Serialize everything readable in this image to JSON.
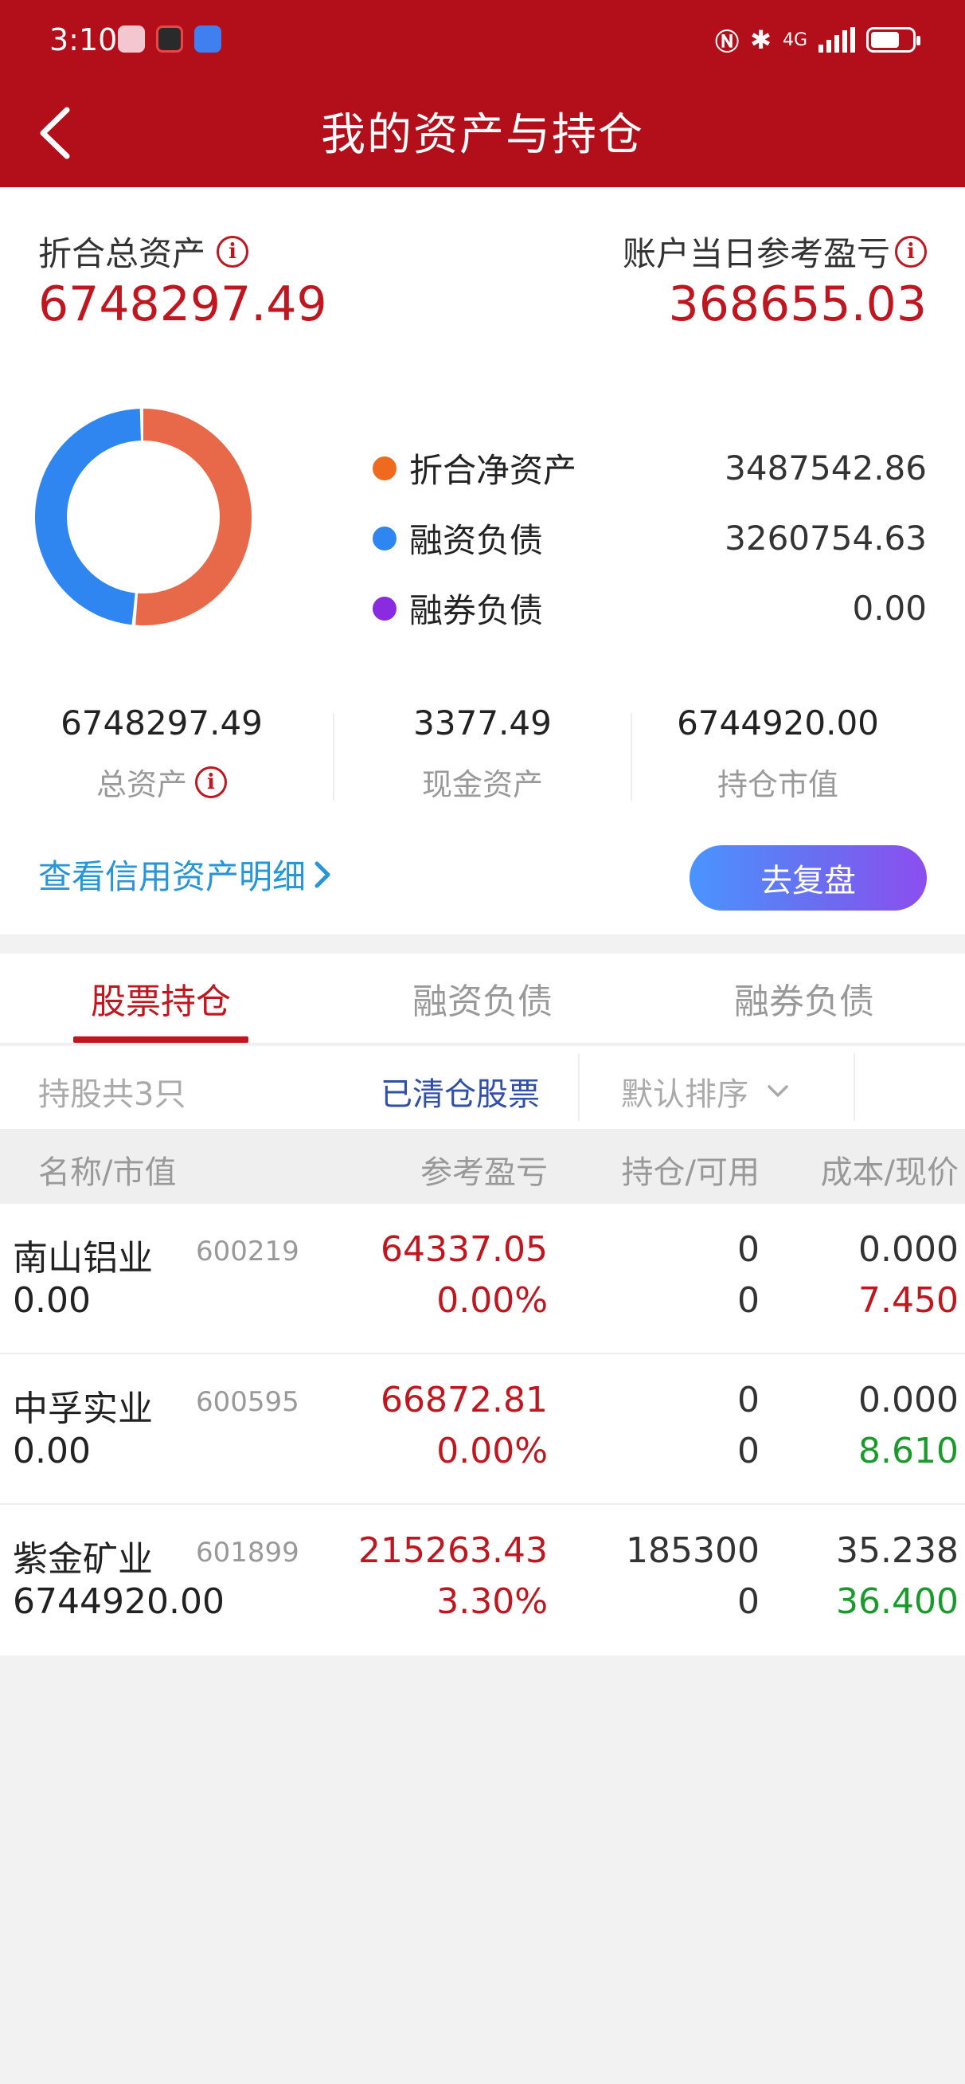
{
  "status_bar": {
    "time": "3:10",
    "network": "4G"
  },
  "header": {
    "title": "我的资产与持仓"
  },
  "summary": {
    "total_assets_label": "折合总资产",
    "total_assets_value": "6748297.49",
    "daily_pnl_label": "账户当日参考盈亏",
    "daily_pnl_value": "368655.03"
  },
  "chart_data": {
    "type": "pie",
    "categories": [
      "折合净资产",
      "融资负债",
      "融券负债"
    ],
    "values": [
      3487542.86,
      3260754.63,
      0.0
    ],
    "display_values": [
      "3487542.86",
      "3260754.63",
      "0.00"
    ],
    "colors": [
      "#e8694a",
      "#2f86f0",
      "#8a2be2"
    ],
    "legend_dot_colors": [
      "#ef6a1f",
      "#2f86f0",
      "#8a2be2"
    ]
  },
  "stats": [
    {
      "value": "6748297.49",
      "label": "总资产",
      "has_info": true
    },
    {
      "value": "3377.49",
      "label": "现金资产",
      "has_info": false
    },
    {
      "value": "6744920.00",
      "label": "持仓市值",
      "has_info": false
    }
  ],
  "actions": {
    "credit_detail_link": "查看信用资产明细",
    "review_button": "去复盘"
  },
  "tabs": [
    {
      "label": "股票持仓",
      "active": true
    },
    {
      "label": "融资负债",
      "active": false
    },
    {
      "label": "融券负债",
      "active": false
    }
  ],
  "filter": {
    "count_text": "持股共3只",
    "cleared_stocks": "已清仓股票",
    "sort_label": "默认排序"
  },
  "table": {
    "columns": [
      "名称/市值",
      "参考盈亏",
      "持仓/可用",
      "成本/现价"
    ],
    "rows": [
      {
        "name": "南山铝业",
        "code": "600219",
        "market_value": "0.00",
        "pnl": "64337.05",
        "pnl_pct": "0.00%",
        "position": "0",
        "available": "0",
        "cost": "0.000",
        "price": "7.450",
        "price_color": "red"
      },
      {
        "name": "中孚实业",
        "code": "600595",
        "market_value": "0.00",
        "pnl": "66872.81",
        "pnl_pct": "0.00%",
        "position": "0",
        "available": "0",
        "cost": "0.000",
        "price": "8.610",
        "price_color": "green"
      },
      {
        "name": "紫金矿业",
        "code": "601899",
        "market_value": "6744920.00",
        "pnl": "215263.43",
        "pnl_pct": "3.30%",
        "position": "185300",
        "available": "0",
        "cost": "35.238",
        "price": "36.400",
        "price_color": "green"
      }
    ]
  },
  "colors": {
    "header_red": "#b30f1b",
    "accent_red": "#c0161f",
    "link_blue": "#2796d8",
    "gain_green": "#1a9a2a"
  }
}
